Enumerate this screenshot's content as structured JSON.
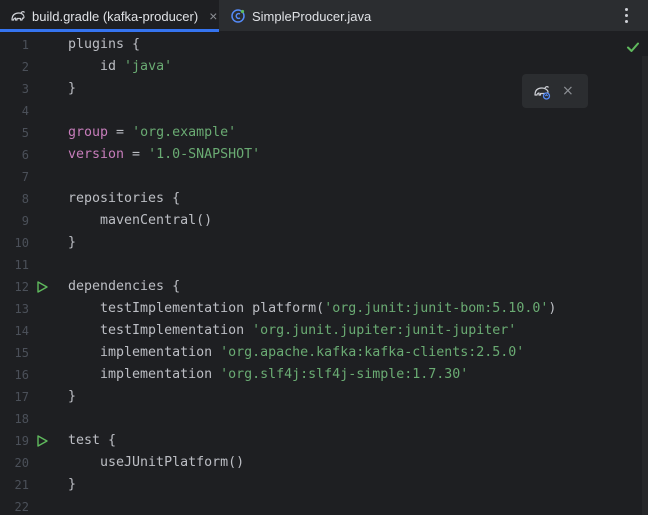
{
  "tabs": [
    {
      "label": "build.gradle (kafka-producer)",
      "icon": "gradle-elephant-icon",
      "active": true,
      "close": "×"
    },
    {
      "label": "SimpleProducer.java",
      "icon": "java-class-icon",
      "active": false
    }
  ],
  "tab_menu_icon": "more-vertical-icon",
  "popup": {
    "icon": "gradle-sync-icon",
    "close": "×"
  },
  "inspection_status_icon": "checkmark-icon",
  "colors": {
    "keyword_property": "#c77dbb",
    "string": "#6aab73",
    "default_text": "#bcbec4",
    "line_number": "#4b5059",
    "run_gutter": "#5fb95d",
    "accent_tab": "#3574f0",
    "background": "#1e1f22"
  },
  "editor": {
    "lines": [
      {
        "n": "1",
        "run": false,
        "tokens": [
          {
            "t": "plugins {",
            "k": "def"
          }
        ]
      },
      {
        "n": "2",
        "run": false,
        "tokens": [
          {
            "t": "    id ",
            "k": "def"
          },
          {
            "t": "'java'",
            "k": "str"
          }
        ]
      },
      {
        "n": "3",
        "run": false,
        "tokens": [
          {
            "t": "}",
            "k": "def"
          }
        ]
      },
      {
        "n": "4",
        "run": false,
        "tokens": []
      },
      {
        "n": "5",
        "run": false,
        "tokens": [
          {
            "t": "group",
            "k": "prop"
          },
          {
            "t": " = ",
            "k": "def"
          },
          {
            "t": "'org.example'",
            "k": "str"
          }
        ]
      },
      {
        "n": "6",
        "run": false,
        "tokens": [
          {
            "t": "version",
            "k": "prop"
          },
          {
            "t": " = ",
            "k": "def"
          },
          {
            "t": "'1.0-SNAPSHOT'",
            "k": "str"
          }
        ]
      },
      {
        "n": "7",
        "run": false,
        "tokens": []
      },
      {
        "n": "8",
        "run": false,
        "tokens": [
          {
            "t": "repositories {",
            "k": "def"
          }
        ]
      },
      {
        "n": "9",
        "run": false,
        "tokens": [
          {
            "t": "    mavenCentral()",
            "k": "def"
          }
        ]
      },
      {
        "n": "10",
        "run": false,
        "tokens": [
          {
            "t": "}",
            "k": "def"
          }
        ]
      },
      {
        "n": "11",
        "run": false,
        "tokens": []
      },
      {
        "n": "12",
        "run": true,
        "tokens": [
          {
            "t": "dependencies {",
            "k": "def"
          }
        ]
      },
      {
        "n": "13",
        "run": false,
        "tokens": [
          {
            "t": "    testImplementation platform(",
            "k": "def"
          },
          {
            "t": "'org.junit:junit-bom:5.10.0'",
            "k": "str"
          },
          {
            "t": ")",
            "k": "def"
          }
        ]
      },
      {
        "n": "14",
        "run": false,
        "tokens": [
          {
            "t": "    testImplementation ",
            "k": "def"
          },
          {
            "t": "'org.junit.jupiter:junit-jupiter'",
            "k": "str"
          }
        ]
      },
      {
        "n": "15",
        "run": false,
        "tokens": [
          {
            "t": "    implementation ",
            "k": "def"
          },
          {
            "t": "'org.apache.kafka:kafka-clients:2.5.0'",
            "k": "str"
          }
        ]
      },
      {
        "n": "16",
        "run": false,
        "tokens": [
          {
            "t": "    implementation ",
            "k": "def"
          },
          {
            "t": "'org.slf4j:slf4j-simple:1.7.30'",
            "k": "str"
          }
        ]
      },
      {
        "n": "17",
        "run": false,
        "tokens": [
          {
            "t": "}",
            "k": "def"
          }
        ]
      },
      {
        "n": "18",
        "run": false,
        "tokens": []
      },
      {
        "n": "19",
        "run": true,
        "tokens": [
          {
            "t": "test {",
            "k": "def"
          }
        ]
      },
      {
        "n": "20",
        "run": false,
        "tokens": [
          {
            "t": "    useJUnitPlatform()",
            "k": "def"
          }
        ]
      },
      {
        "n": "21",
        "run": false,
        "tokens": [
          {
            "t": "}",
            "k": "def"
          }
        ]
      },
      {
        "n": "22",
        "run": false,
        "tokens": []
      }
    ]
  }
}
